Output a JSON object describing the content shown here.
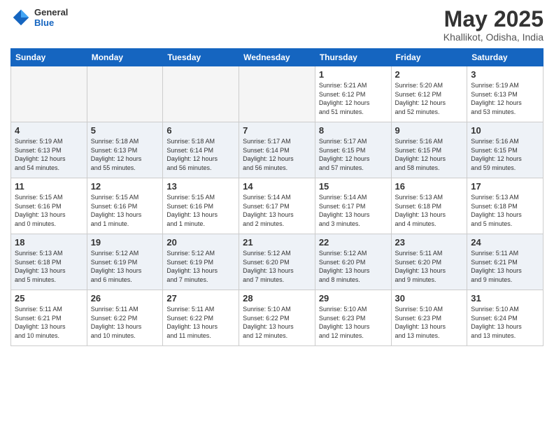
{
  "header": {
    "logo_general": "General",
    "logo_blue": "Blue",
    "title": "May 2025",
    "location": "Khallikot, Odisha, India"
  },
  "weekdays": [
    "Sunday",
    "Monday",
    "Tuesday",
    "Wednesday",
    "Thursday",
    "Friday",
    "Saturday"
  ],
  "weeks": [
    [
      {
        "day": "",
        "info": ""
      },
      {
        "day": "",
        "info": ""
      },
      {
        "day": "",
        "info": ""
      },
      {
        "day": "",
        "info": ""
      },
      {
        "day": "1",
        "info": "Sunrise: 5:21 AM\nSunset: 6:12 PM\nDaylight: 12 hours\nand 51 minutes."
      },
      {
        "day": "2",
        "info": "Sunrise: 5:20 AM\nSunset: 6:12 PM\nDaylight: 12 hours\nand 52 minutes."
      },
      {
        "day": "3",
        "info": "Sunrise: 5:19 AM\nSunset: 6:13 PM\nDaylight: 12 hours\nand 53 minutes."
      }
    ],
    [
      {
        "day": "4",
        "info": "Sunrise: 5:19 AM\nSunset: 6:13 PM\nDaylight: 12 hours\nand 54 minutes."
      },
      {
        "day": "5",
        "info": "Sunrise: 5:18 AM\nSunset: 6:13 PM\nDaylight: 12 hours\nand 55 minutes."
      },
      {
        "day": "6",
        "info": "Sunrise: 5:18 AM\nSunset: 6:14 PM\nDaylight: 12 hours\nand 56 minutes."
      },
      {
        "day": "7",
        "info": "Sunrise: 5:17 AM\nSunset: 6:14 PM\nDaylight: 12 hours\nand 56 minutes."
      },
      {
        "day": "8",
        "info": "Sunrise: 5:17 AM\nSunset: 6:15 PM\nDaylight: 12 hours\nand 57 minutes."
      },
      {
        "day": "9",
        "info": "Sunrise: 5:16 AM\nSunset: 6:15 PM\nDaylight: 12 hours\nand 58 minutes."
      },
      {
        "day": "10",
        "info": "Sunrise: 5:16 AM\nSunset: 6:15 PM\nDaylight: 12 hours\nand 59 minutes."
      }
    ],
    [
      {
        "day": "11",
        "info": "Sunrise: 5:15 AM\nSunset: 6:16 PM\nDaylight: 13 hours\nand 0 minutes."
      },
      {
        "day": "12",
        "info": "Sunrise: 5:15 AM\nSunset: 6:16 PM\nDaylight: 13 hours\nand 1 minute."
      },
      {
        "day": "13",
        "info": "Sunrise: 5:15 AM\nSunset: 6:16 PM\nDaylight: 13 hours\nand 1 minute."
      },
      {
        "day": "14",
        "info": "Sunrise: 5:14 AM\nSunset: 6:17 PM\nDaylight: 13 hours\nand 2 minutes."
      },
      {
        "day": "15",
        "info": "Sunrise: 5:14 AM\nSunset: 6:17 PM\nDaylight: 13 hours\nand 3 minutes."
      },
      {
        "day": "16",
        "info": "Sunrise: 5:13 AM\nSunset: 6:18 PM\nDaylight: 13 hours\nand 4 minutes."
      },
      {
        "day": "17",
        "info": "Sunrise: 5:13 AM\nSunset: 6:18 PM\nDaylight: 13 hours\nand 5 minutes."
      }
    ],
    [
      {
        "day": "18",
        "info": "Sunrise: 5:13 AM\nSunset: 6:18 PM\nDaylight: 13 hours\nand 5 minutes."
      },
      {
        "day": "19",
        "info": "Sunrise: 5:12 AM\nSunset: 6:19 PM\nDaylight: 13 hours\nand 6 minutes."
      },
      {
        "day": "20",
        "info": "Sunrise: 5:12 AM\nSunset: 6:19 PM\nDaylight: 13 hours\nand 7 minutes."
      },
      {
        "day": "21",
        "info": "Sunrise: 5:12 AM\nSunset: 6:20 PM\nDaylight: 13 hours\nand 7 minutes."
      },
      {
        "day": "22",
        "info": "Sunrise: 5:12 AM\nSunset: 6:20 PM\nDaylight: 13 hours\nand 8 minutes."
      },
      {
        "day": "23",
        "info": "Sunrise: 5:11 AM\nSunset: 6:20 PM\nDaylight: 13 hours\nand 9 minutes."
      },
      {
        "day": "24",
        "info": "Sunrise: 5:11 AM\nSunset: 6:21 PM\nDaylight: 13 hours\nand 9 minutes."
      }
    ],
    [
      {
        "day": "25",
        "info": "Sunrise: 5:11 AM\nSunset: 6:21 PM\nDaylight: 13 hours\nand 10 minutes."
      },
      {
        "day": "26",
        "info": "Sunrise: 5:11 AM\nSunset: 6:22 PM\nDaylight: 13 hours\nand 10 minutes."
      },
      {
        "day": "27",
        "info": "Sunrise: 5:11 AM\nSunset: 6:22 PM\nDaylight: 13 hours\nand 11 minutes."
      },
      {
        "day": "28",
        "info": "Sunrise: 5:10 AM\nSunset: 6:22 PM\nDaylight: 13 hours\nand 12 minutes."
      },
      {
        "day": "29",
        "info": "Sunrise: 5:10 AM\nSunset: 6:23 PM\nDaylight: 13 hours\nand 12 minutes."
      },
      {
        "day": "30",
        "info": "Sunrise: 5:10 AM\nSunset: 6:23 PM\nDaylight: 13 hours\nand 13 minutes."
      },
      {
        "day": "31",
        "info": "Sunrise: 5:10 AM\nSunset: 6:24 PM\nDaylight: 13 hours\nand 13 minutes."
      }
    ]
  ]
}
